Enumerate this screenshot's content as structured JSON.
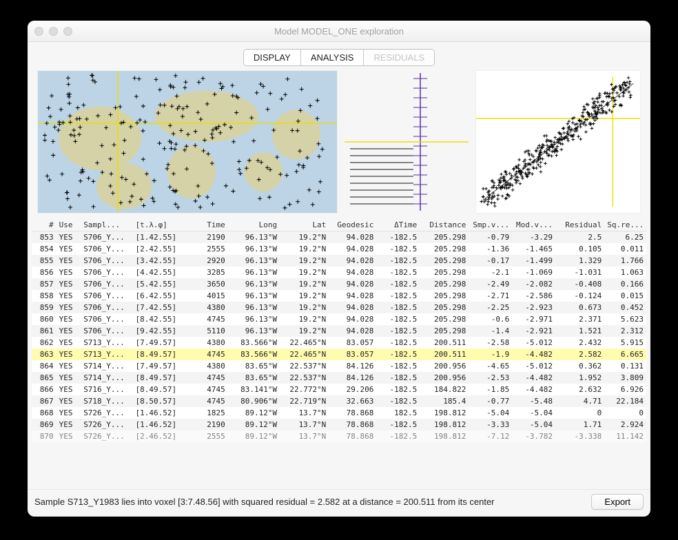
{
  "window": {
    "title": "Model MODEL_ONE exploration"
  },
  "tabs": {
    "display": "DISPLAY",
    "analysis": "ANALYSIS",
    "residuals": "RESIDUALS"
  },
  "columns": [
    "#",
    "Use",
    "Sampl...",
    "[t.λ.φ]",
    "Time",
    "Long",
    "Lat",
    "Geodesic",
    "ΔTime",
    "Distance",
    "Smp.v...",
    "Mod.v...",
    "Residual",
    "Sq.re..."
  ],
  "rows": [
    {
      "n": "853",
      "use": "YES",
      "samp": "S706_Y...",
      "voxel": "[1.42.55]",
      "time": "2190",
      "long": "96.13°W",
      "lat": "19.2°N",
      "geo": "94.028",
      "dt": "-182.5",
      "dist": "205.298",
      "smp": "-0.79",
      "mod": "-3.29",
      "res": "2.5",
      "sq": "6.25"
    },
    {
      "n": "854",
      "use": "YES",
      "samp": "S706_Y...",
      "voxel": "[2.42.55]",
      "time": "2555",
      "long": "96.13°W",
      "lat": "19.2°N",
      "geo": "94.028",
      "dt": "-182.5",
      "dist": "205.298",
      "smp": "-1.36",
      "mod": "-1.465",
      "res": "0.105",
      "sq": "0.011"
    },
    {
      "n": "855",
      "use": "YES",
      "samp": "S706_Y...",
      "voxel": "[3.42.55]",
      "time": "2920",
      "long": "96.13°W",
      "lat": "19.2°N",
      "geo": "94.028",
      "dt": "-182.5",
      "dist": "205.298",
      "smp": "-0.17",
      "mod": "-1.499",
      "res": "1.329",
      "sq": "1.766"
    },
    {
      "n": "856",
      "use": "YES",
      "samp": "S706_Y...",
      "voxel": "[4.42.55]",
      "time": "3285",
      "long": "96.13°W",
      "lat": "19.2°N",
      "geo": "94.028",
      "dt": "-182.5",
      "dist": "205.298",
      "smp": "-2.1",
      "mod": "-1.069",
      "res": "-1.031",
      "sq": "1.063"
    },
    {
      "n": "857",
      "use": "YES",
      "samp": "S706_Y...",
      "voxel": "[5.42.55]",
      "time": "3650",
      "long": "96.13°W",
      "lat": "19.2°N",
      "geo": "94.028",
      "dt": "-182.5",
      "dist": "205.298",
      "smp": "-2.49",
      "mod": "-2.082",
      "res": "-0.408",
      "sq": "0.166"
    },
    {
      "n": "858",
      "use": "YES",
      "samp": "S706_Y...",
      "voxel": "[6.42.55]",
      "time": "4015",
      "long": "96.13°W",
      "lat": "19.2°N",
      "geo": "94.028",
      "dt": "-182.5",
      "dist": "205.298",
      "smp": "-2.71",
      "mod": "-2.586",
      "res": "-0.124",
      "sq": "0.015"
    },
    {
      "n": "859",
      "use": "YES",
      "samp": "S706_Y...",
      "voxel": "[7.42.55]",
      "time": "4380",
      "long": "96.13°W",
      "lat": "19.2°N",
      "geo": "94.028",
      "dt": "-182.5",
      "dist": "205.298",
      "smp": "-2.25",
      "mod": "-2.923",
      "res": "0.673",
      "sq": "0.452"
    },
    {
      "n": "860",
      "use": "YES",
      "samp": "S706_Y...",
      "voxel": "[8.42.55]",
      "time": "4745",
      "long": "96.13°W",
      "lat": "19.2°N",
      "geo": "94.028",
      "dt": "-182.5",
      "dist": "205.298",
      "smp": "-0.6",
      "mod": "-2.971",
      "res": "2.371",
      "sq": "5.623"
    },
    {
      "n": "861",
      "use": "YES",
      "samp": "S706_Y...",
      "voxel": "[9.42.55]",
      "time": "5110",
      "long": "96.13°W",
      "lat": "19.2°N",
      "geo": "94.028",
      "dt": "-182.5",
      "dist": "205.298",
      "smp": "-1.4",
      "mod": "-2.921",
      "res": "1.521",
      "sq": "2.312"
    },
    {
      "n": "862",
      "use": "YES",
      "samp": "S713_Y...",
      "voxel": "[7.49.57]",
      "time": "4380",
      "long": "83.566°W",
      "lat": "22.465°N",
      "geo": "83.057",
      "dt": "-182.5",
      "dist": "200.511",
      "smp": "-2.58",
      "mod": "-5.012",
      "res": "2.432",
      "sq": "5.915"
    },
    {
      "n": "863",
      "use": "YES",
      "samp": "S713_Y...",
      "voxel": "[8.49.57]",
      "time": "4745",
      "long": "83.566°W",
      "lat": "22.465°N",
      "geo": "83.057",
      "dt": "-182.5",
      "dist": "200.511",
      "smp": "-1.9",
      "mod": "-4.482",
      "res": "2.582",
      "sq": "6.665",
      "sel": true
    },
    {
      "n": "864",
      "use": "YES",
      "samp": "S714_Y...",
      "voxel": "[7.49.57]",
      "time": "4380",
      "long": "83.65°W",
      "lat": "22.537°N",
      "geo": "84.126",
      "dt": "-182.5",
      "dist": "200.956",
      "smp": "-4.65",
      "mod": "-5.012",
      "res": "0.362",
      "sq": "0.131"
    },
    {
      "n": "865",
      "use": "YES",
      "samp": "S714_Y...",
      "voxel": "[8.49.57]",
      "time": "4745",
      "long": "83.65°W",
      "lat": "22.537°N",
      "geo": "84.126",
      "dt": "-182.5",
      "dist": "200.956",
      "smp": "-2.53",
      "mod": "-4.482",
      "res": "1.952",
      "sq": "3.809"
    },
    {
      "n": "866",
      "use": "YES",
      "samp": "S716_Y...",
      "voxel": "[8.49.57]",
      "time": "4745",
      "long": "83.141°W",
      "lat": "22.772°N",
      "geo": "29.206",
      "dt": "-182.5",
      "dist": "184.822",
      "smp": "-1.85",
      "mod": "-4.482",
      "res": "2.632",
      "sq": "6.926"
    },
    {
      "n": "867",
      "use": "YES",
      "samp": "S718_Y...",
      "voxel": "[8.50.57]",
      "time": "4745",
      "long": "80.906°W",
      "lat": "22.719°N",
      "geo": "32.663",
      "dt": "-182.5",
      "dist": "185.4",
      "smp": "-0.77",
      "mod": "-5.48",
      "res": "4.71",
      "sq": "22.184"
    },
    {
      "n": "868",
      "use": "YES",
      "samp": "S726_Y...",
      "voxel": "[1.46.52]",
      "time": "1825",
      "long": "89.12°W",
      "lat": "13.7°N",
      "geo": "78.868",
      "dt": "182.5",
      "dist": "198.812",
      "smp": "-5.04",
      "mod": "-5.04",
      "res": "0",
      "sq": "0"
    },
    {
      "n": "869",
      "use": "YES",
      "samp": "S726_Y...",
      "voxel": "[1.46.52]",
      "time": "2190",
      "long": "89.12°W",
      "lat": "13.7°N",
      "geo": "78.868",
      "dt": "-182.5",
      "dist": "198.812",
      "smp": "-3.33",
      "mod": "-5.04",
      "res": "1.71",
      "sq": "2.924"
    },
    {
      "n": "870",
      "use": "YES",
      "samp": "S726_Y...",
      "voxel": "[2.46.52]",
      "time": "2555",
      "long": "89.12°W",
      "lat": "13.7°N",
      "geo": "78.868",
      "dt": "-182.5",
      "dist": "198.812",
      "smp": "-7.12",
      "mod": "-3.782",
      "res": "-3.338",
      "sq": "11.142",
      "cut": true
    }
  ],
  "status": "Sample S713_Y1983 lies into voxel [3:7.48.56] with squared residual = 2.582 at a distance = 200.511 from its center",
  "export_label": "Export",
  "colors": {
    "ocean": "#bcd4e6",
    "land": "#d8d2a0",
    "cross_h": "#e8e000",
    "cross_v": "#e8e000",
    "axis": "#5a2aa0"
  }
}
